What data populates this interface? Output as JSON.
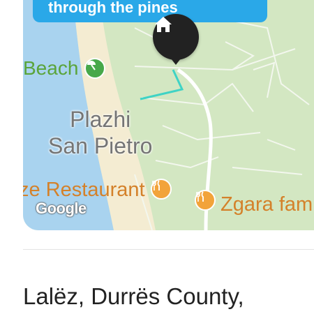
{
  "map": {
    "callout_text": "through the pines",
    "labels": {
      "beach": "Beach",
      "area_line1": "Plazhi",
      "area_line2": "San Pietro",
      "restaurant": "ze Restaurant",
      "zgara": "Zgara fam"
    },
    "attribution": "Google",
    "icons": {
      "home_pin": "home-icon",
      "beach_poi": "beach-umbrella-icon",
      "food_poi": "restaurant-icon"
    },
    "colors": {
      "callout": "#2aa8e8",
      "beach_label": "#5aa43a",
      "restaurant_label": "#d4812a",
      "route": "#3fd3c5"
    }
  },
  "listing": {
    "location": "Lalëz, Durrës County,"
  }
}
